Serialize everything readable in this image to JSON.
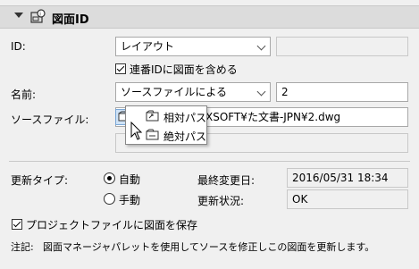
{
  "header": {
    "title": "図面ID"
  },
  "id_row": {
    "label": "ID:",
    "combo_value": "レイアウト",
    "side_value": ""
  },
  "include_check": {
    "label": "連番IDに図面を含める",
    "checked": true
  },
  "name_row": {
    "label": "名前:",
    "combo_value": "ソースファイルによる",
    "side_value": "2"
  },
  "source_row": {
    "label": "ソースファイル:",
    "path_visible": "XSOFT¥た文書-JPN¥2.dwg"
  },
  "popup_menu": {
    "items": [
      "相対パス",
      "絶対パス"
    ]
  },
  "update_type": {
    "label": "更新タイプ:",
    "options": [
      "自動",
      "手動"
    ],
    "selected": "自動"
  },
  "last_modified": {
    "label": "最終変更日:",
    "value": "2016/05/31 18:34"
  },
  "update_status": {
    "label": "更新状況:",
    "value": "OK"
  },
  "save_check": {
    "label": "プロジェクトファイルに図面を保存",
    "checked": true
  },
  "note": {
    "prefix": "注記:",
    "text": "図面マネージャパレットを使用してソースを修正しこの図面を更新します。"
  }
}
